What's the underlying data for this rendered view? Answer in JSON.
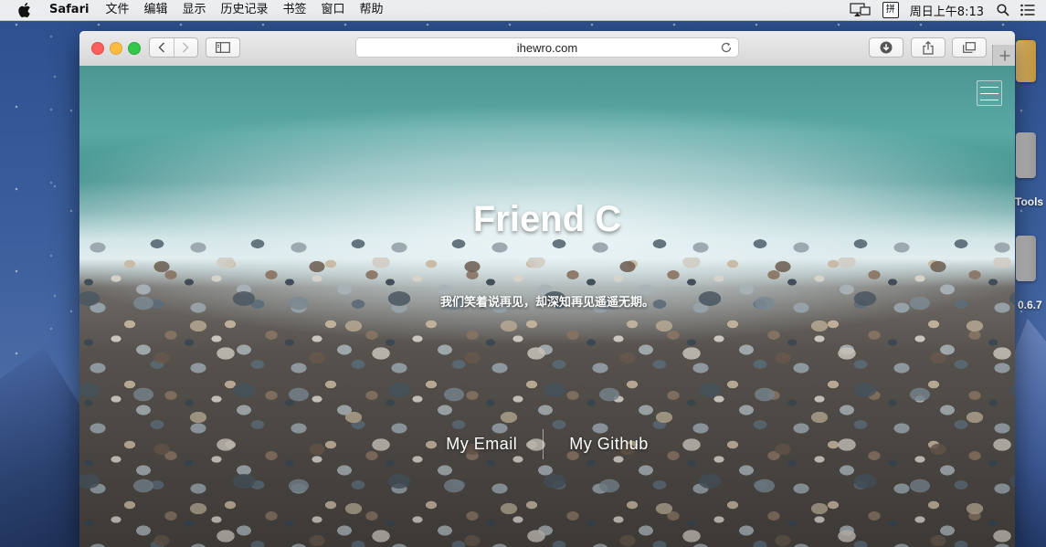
{
  "menubar": {
    "app_name": "Safari",
    "items": [
      "文件",
      "编辑",
      "显示",
      "历史记录",
      "书签",
      "窗口",
      "帮助"
    ],
    "ime_label": "拼",
    "clock": "周日上午8:13"
  },
  "browser": {
    "url": "ihewro.com"
  },
  "page": {
    "title": "Friend C",
    "subtitle": "我们笑着说再见，却深知再见遥遥无期。",
    "links": [
      "My Email",
      "My Github"
    ]
  },
  "desktop": {
    "labels": [
      "Tools",
      "0.6.7"
    ]
  }
}
